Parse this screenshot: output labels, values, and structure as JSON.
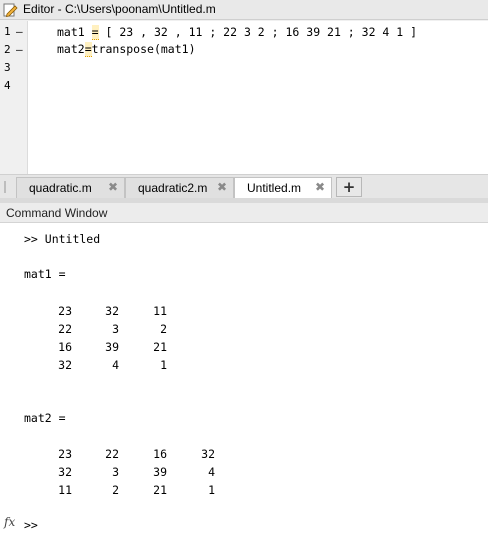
{
  "editor": {
    "title": "Editor - C:\\Users\\poonam\\Untitled.m",
    "line_numbers": [
      "1",
      "2",
      "3",
      "4"
    ],
    "line_markers": [
      "–",
      "–"
    ],
    "code": {
      "line1_a": "mat1 ",
      "line1_warn": "=",
      "line1_b": " [ 23 , 32 , 11 ; 22 3 2 ; 16 39 21 ; 32 4 1 ]",
      "line2_a": "mat2",
      "line2_warn": "=",
      "line2_b": "transpose(mat1)"
    }
  },
  "tabs": [
    {
      "label": "quadratic.m",
      "close": "✖"
    },
    {
      "label": "quadratic2.m",
      "close": "✖"
    },
    {
      "label": "Untitled.m",
      "close": "✖"
    }
  ],
  "new_tab_label": "+",
  "command_window": {
    "title": "Command Window",
    "command": ">> Untitled",
    "mat1_label": "mat1 =",
    "mat1": [
      [
        "23",
        "32",
        "11"
      ],
      [
        "22",
        "3",
        "2"
      ],
      [
        "16",
        "39",
        "21"
      ],
      [
        "32",
        "4",
        "1"
      ]
    ],
    "mat2_label": "mat2 =",
    "mat2": [
      [
        "23",
        "22",
        "16",
        "32"
      ],
      [
        "32",
        "3",
        "39",
        "4"
      ],
      [
        "11",
        "2",
        "21",
        "1"
      ]
    ],
    "fx_symbol": "fx",
    "prompt": ">>"
  },
  "icons": {
    "editor": "pencil-doc-icon",
    "close": "close-icon",
    "fx": "function-browser-icon"
  }
}
